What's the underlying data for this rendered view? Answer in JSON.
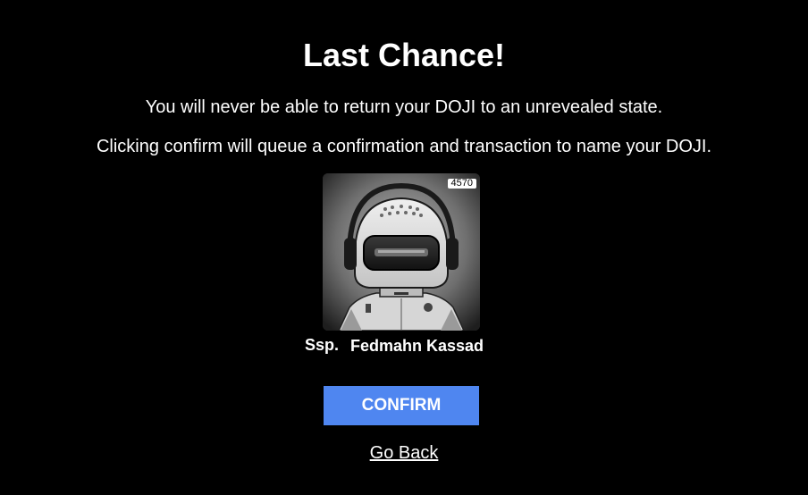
{
  "dialog": {
    "title": "Last Chance!",
    "warning_line": "You will never be able to return your DOJI to an unrevealed state.",
    "info_line": "Clicking confirm will queue a confirmation and transaction to name your DOJI."
  },
  "doji": {
    "token_number": "4570",
    "name_prefix": "Ssp.",
    "name": "Fedmahn Kassad",
    "image_icon": "robot-helmet-with-headphones-icon"
  },
  "actions": {
    "confirm_label": "CONFIRM",
    "go_back_label": "Go Back"
  },
  "colors": {
    "background": "#000000",
    "text": "#ffffff",
    "confirm_button": "#4f86f0"
  }
}
